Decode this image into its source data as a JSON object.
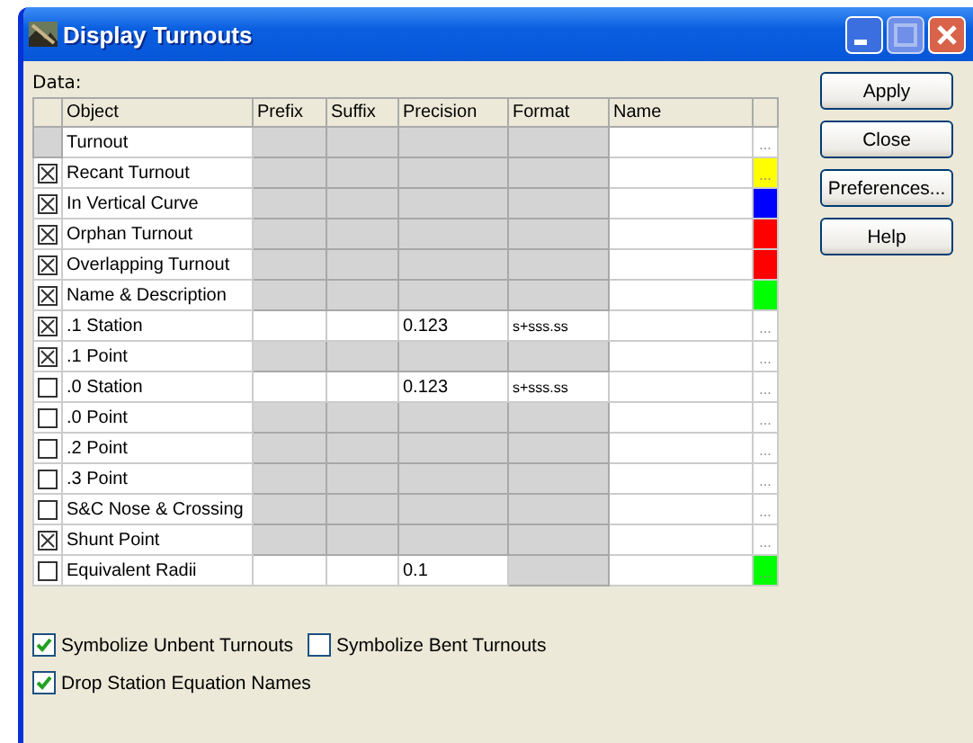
{
  "window": {
    "title": "Display Turnouts"
  },
  "data_label": "Data:",
  "table": {
    "columns": [
      "Object",
      "Prefix",
      "Suffix",
      "Precision",
      "Format",
      "Name"
    ],
    "rows": [
      {
        "kind": "group",
        "cells": [
          {
            "text": "Turnout",
            "disabled": false
          },
          {
            "disabled": true
          },
          {
            "disabled": true
          },
          {
            "disabled": true
          },
          {
            "disabled": true
          },
          {
            "disabled": false
          }
        ],
        "button": "..."
      },
      {
        "kind": "item",
        "checked": true,
        "cells": [
          {
            "text": "Recant Turnout",
            "disabled": false
          },
          {
            "disabled": true
          },
          {
            "disabled": true
          },
          {
            "disabled": true
          },
          {
            "disabled": true
          },
          {
            "disabled": false
          }
        ],
        "button": "...",
        "color": "#ffff00"
      },
      {
        "kind": "item",
        "checked": true,
        "cells": [
          {
            "text": "In Vertical Curve",
            "disabled": false
          },
          {
            "disabled": true
          },
          {
            "disabled": true
          },
          {
            "disabled": true
          },
          {
            "disabled": true
          },
          {
            "disabled": false
          }
        ],
        "color": "#0000ff"
      },
      {
        "kind": "item",
        "checked": true,
        "cells": [
          {
            "text": "Orphan Turnout",
            "disabled": false
          },
          {
            "disabled": true
          },
          {
            "disabled": true
          },
          {
            "disabled": true
          },
          {
            "disabled": true
          },
          {
            "disabled": false
          }
        ],
        "color": "#ff0000"
      },
      {
        "kind": "item",
        "checked": true,
        "cells": [
          {
            "text": "Overlapping Turnout",
            "disabled": false
          },
          {
            "disabled": true
          },
          {
            "disabled": true
          },
          {
            "disabled": true
          },
          {
            "disabled": true
          },
          {
            "disabled": false
          }
        ],
        "color": "#ff0000"
      },
      {
        "kind": "item",
        "checked": true,
        "cells": [
          {
            "text": "Name & Description",
            "disabled": false
          },
          {
            "disabled": true
          },
          {
            "disabled": true
          },
          {
            "disabled": true
          },
          {
            "disabled": true
          },
          {
            "disabled": false
          }
        ],
        "color": "#00ff00"
      },
      {
        "kind": "item",
        "checked": true,
        "cells": [
          {
            "text": ".1 Station",
            "disabled": false
          },
          {
            "disabled": false
          },
          {
            "disabled": false
          },
          {
            "disabled": false,
            "text": "0.123"
          },
          {
            "disabled": false,
            "text": "s+sss.ss"
          },
          {
            "disabled": false
          }
        ],
        "button": "..."
      },
      {
        "kind": "item",
        "checked": true,
        "cells": [
          {
            "text": ".1 Point",
            "disabled": false
          },
          {
            "disabled": true
          },
          {
            "disabled": true
          },
          {
            "disabled": true
          },
          {
            "disabled": true
          },
          {
            "disabled": false
          }
        ],
        "button": "..."
      },
      {
        "kind": "item",
        "checked": false,
        "cells": [
          {
            "text": ".0 Station",
            "disabled": false
          },
          {
            "disabled": false
          },
          {
            "disabled": false
          },
          {
            "disabled": false,
            "text": "0.123"
          },
          {
            "disabled": false,
            "text": "s+sss.ss"
          },
          {
            "disabled": false
          }
        ],
        "button": "..."
      },
      {
        "kind": "item",
        "checked": false,
        "cells": [
          {
            "text": ".0 Point",
            "disabled": false
          },
          {
            "disabled": true
          },
          {
            "disabled": true
          },
          {
            "disabled": true
          },
          {
            "disabled": true
          },
          {
            "disabled": false
          }
        ],
        "button": "..."
      },
      {
        "kind": "item",
        "checked": false,
        "cells": [
          {
            "text": ".2 Point",
            "disabled": false
          },
          {
            "disabled": true
          },
          {
            "disabled": true
          },
          {
            "disabled": true
          },
          {
            "disabled": true
          },
          {
            "disabled": false
          }
        ],
        "button": "..."
      },
      {
        "kind": "item",
        "checked": false,
        "cells": [
          {
            "text": ".3 Point",
            "disabled": false
          },
          {
            "disabled": true
          },
          {
            "disabled": true
          },
          {
            "disabled": true
          },
          {
            "disabled": true
          },
          {
            "disabled": false
          }
        ],
        "button": "..."
      },
      {
        "kind": "item",
        "checked": false,
        "cells": [
          {
            "text": "S&C Nose & Crossing",
            "disabled": false
          },
          {
            "disabled": true
          },
          {
            "disabled": true
          },
          {
            "disabled": true
          },
          {
            "disabled": true
          },
          {
            "disabled": false
          }
        ],
        "button": "..."
      },
      {
        "kind": "item",
        "checked": true,
        "cells": [
          {
            "text": "Shunt Point",
            "disabled": false
          },
          {
            "disabled": true
          },
          {
            "disabled": true
          },
          {
            "disabled": true
          },
          {
            "disabled": true
          },
          {
            "disabled": false
          }
        ],
        "button": "..."
      },
      {
        "kind": "item",
        "checked": false,
        "cells": [
          {
            "text": "Equivalent Radii",
            "disabled": false
          },
          {
            "disabled": false
          },
          {
            "disabled": false
          },
          {
            "disabled": false,
            "text": "0.1"
          },
          {
            "disabled": true
          },
          {
            "disabled": false
          }
        ],
        "button": "...",
        "color": "#00ff00"
      }
    ]
  },
  "buttons": [
    "Apply",
    "Close",
    "Preferences...",
    "Help"
  ],
  "options": [
    [
      {
        "label": "Symbolize Unbent Turnouts",
        "checked": true
      },
      {
        "label": "Symbolize Bent Turnouts",
        "checked": false
      }
    ],
    [
      {
        "label": "Drop Station Equation Names",
        "checked": true
      }
    ]
  ]
}
